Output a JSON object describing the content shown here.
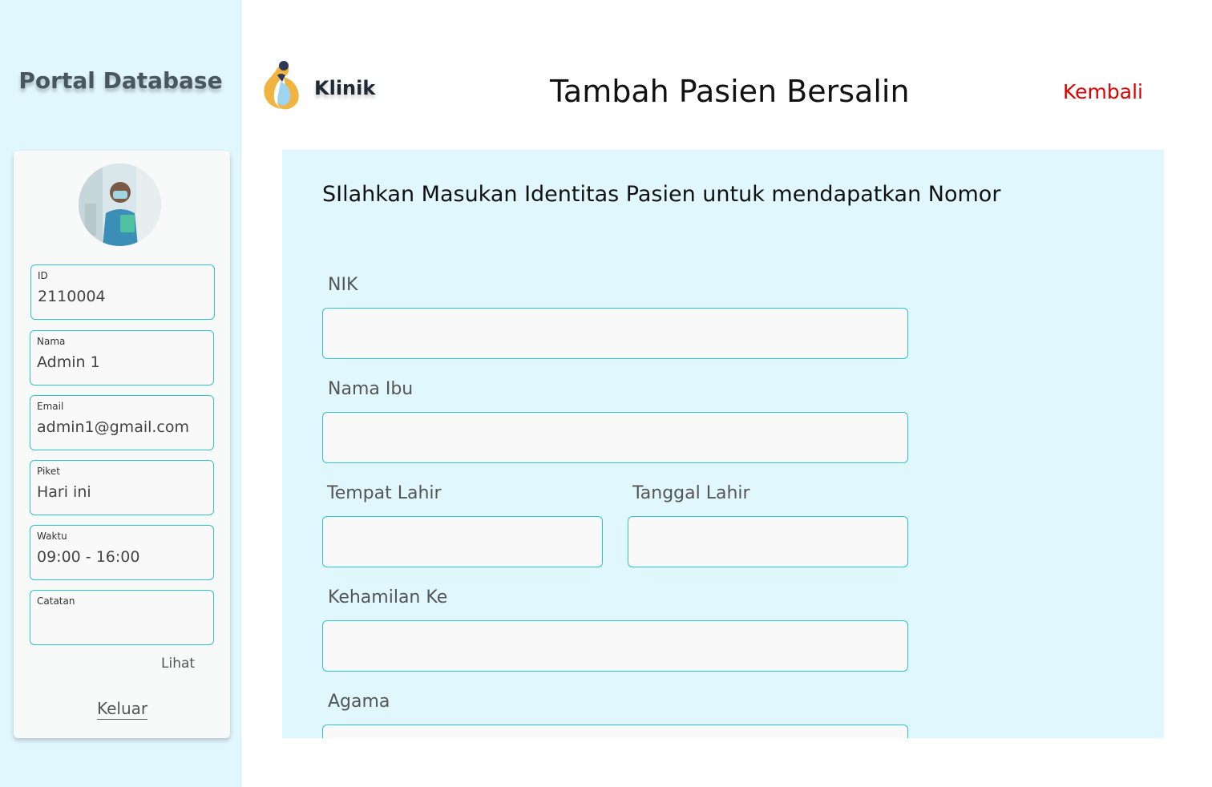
{
  "sidebar": {
    "title": "Portal Database",
    "profile": {
      "fields": [
        {
          "label": "ID",
          "value": "2110004"
        },
        {
          "label": "Nama",
          "value": "Admin 1"
        },
        {
          "label": "Email",
          "value": "admin1@gmail.com"
        },
        {
          "label": "Piket",
          "value": "Hari ini"
        },
        {
          "label": "Waktu",
          "value": "09:00 - 16:00"
        },
        {
          "label": "Catatan",
          "value": ""
        }
      ],
      "view_link": "Lihat",
      "logout_link": "Keluar"
    }
  },
  "header": {
    "brand": "Klinik",
    "title": "Tambah Pasien Bersalin",
    "back_link": "Kembali"
  },
  "form": {
    "heading": "SIlahkan Masukan Identitas Pasien untuk mendapatkan Nomor",
    "fields": {
      "nik": {
        "label": "NIK",
        "value": ""
      },
      "nama_ibu": {
        "label": "Nama Ibu",
        "value": ""
      },
      "tempat_lahir": {
        "label": "Tempat Lahir",
        "value": ""
      },
      "tanggal_lahir": {
        "label": "Tanggal Lahir",
        "value": ""
      },
      "kehamilan_ke": {
        "label": "Kehamilan Ke",
        "value": ""
      },
      "agama": {
        "label": "Agama",
        "value": ""
      }
    }
  },
  "colors": {
    "sidebar_bg": "#e0f7fd",
    "input_border": "#2ec5cf",
    "back_link": "#e00000"
  }
}
